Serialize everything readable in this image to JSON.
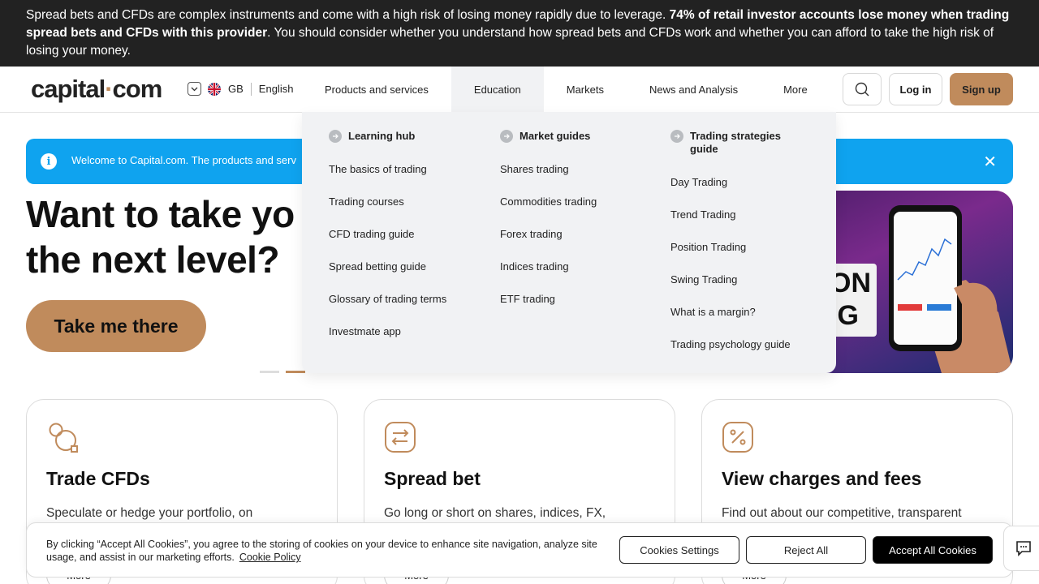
{
  "risk_banner": {
    "text_start": "Spread bets and CFDs are complex instruments and come with a high risk of losing money rapidly due to leverage. ",
    "text_bold": "74% of retail investor accounts lose money when trading spread bets and CFDs with this provider",
    "text_end": ". You should consider whether you understand how spread bets and CFDs work and whether you can afford to take the high risk of losing your money."
  },
  "header": {
    "logo_part1": "capital",
    "logo_dot": "·",
    "logo_part2": "com",
    "country": "GB",
    "language": "English",
    "nav": [
      {
        "label": "Products and services"
      },
      {
        "label": "Education"
      },
      {
        "label": "Markets"
      },
      {
        "label": "News and Analysis"
      },
      {
        "label": "More"
      }
    ],
    "login_label": "Log in",
    "signup_label": "Sign up"
  },
  "notice": {
    "icon": "info-icon",
    "text": "Welcome to Capital.com. The products and serv"
  },
  "hero": {
    "title_line1": "Want to take yo",
    "title_line2": "the next level?",
    "cta_label": "Take me there"
  },
  "mega_menu": {
    "columns": [
      {
        "heading": "Learning hub",
        "items": [
          "The basics of trading",
          "Trading courses",
          "CFD trading guide",
          "Spread betting guide",
          "Glossary of trading terms",
          "Investmate app"
        ]
      },
      {
        "heading": "Market guides",
        "items": [
          "Shares trading",
          "Commodities trading",
          "Forex trading",
          "Indices trading",
          "ETF trading"
        ]
      },
      {
        "heading_line1": "Trading strategies",
        "heading_line2": "guide",
        "items": [
          "Day Trading",
          "Trend Trading",
          "Position Trading",
          "Swing Trading",
          "What is a margin?",
          "Trading psychology guide"
        ]
      }
    ]
  },
  "cards": [
    {
      "title": "Trade CFDs",
      "text": "Speculate or hedge your portfolio, on",
      "more": "More",
      "icon": "circles-icon"
    },
    {
      "title": "Spread bet",
      "text": "Go long or short on shares, indices, FX,",
      "more": "More",
      "icon": "arrows-exchange-icon"
    },
    {
      "title": "View charges and fees",
      "text": "Find out about our competitive, transparent",
      "more": "More",
      "icon": "percent-icon"
    }
  ],
  "cookie": {
    "text": "By clicking “Accept All Cookies”, you agree to the storing of cookies on your device to enhance site navigation, analyze site usage, and assist in our marketing efforts.",
    "policy_link": "Cookie Policy",
    "settings_label": "Cookies Settings",
    "reject_label": "Reject All",
    "accept_label": "Accept All Cookies"
  },
  "colors": {
    "accent": "#c08b5c",
    "banner_bg": "#222222",
    "notice_bg": "#0fa3ef",
    "menu_bg": "#f1f2f4"
  }
}
